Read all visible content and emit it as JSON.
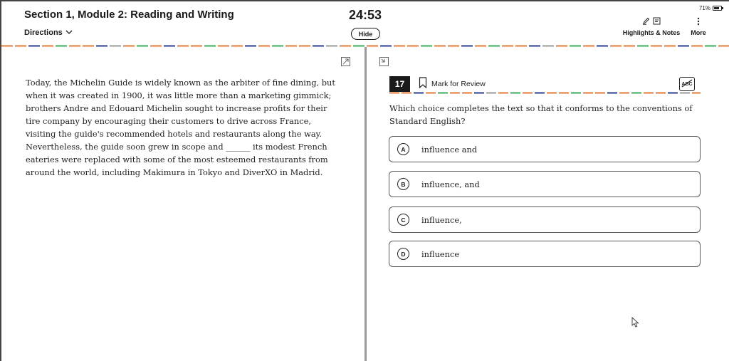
{
  "header": {
    "section_title": "Section 1, Module 2: Reading and Writing",
    "directions_label": "Directions",
    "timer": "24:53",
    "hide_label": "Hide",
    "battery": "71%",
    "highlights_label": "Highlights & Notes",
    "more_label": "More"
  },
  "passage": {
    "text": "Today, the Michelin Guide is widely known as the arbiter of fine dining, but when it was created in 1900, it was little more than a marketing gimmick; brothers Andre and Edouard Michelin sought to increase profits for their tire company by encouraging their customers to drive across France, visiting the guide's recommended hotels and restaurants along the way. Nevertheless, the guide soon grew in scope and ______ its modest French eateries were replaced with some of the most esteemed restaurants from around the world, including Makimura in Tokyo and DiverXO in Madrid."
  },
  "question": {
    "number": "17",
    "mark_for_review_label": "Mark for Review",
    "abc_label": "ABC",
    "prompt": "Which choice completes the text so that it conforms to the conventions of Standard English?",
    "choices": [
      {
        "letter": "A",
        "text": "influence and"
      },
      {
        "letter": "B",
        "text": "influence, and"
      },
      {
        "letter": "C",
        "text": "influence,"
      },
      {
        "letter": "D",
        "text": "influence"
      }
    ]
  },
  "icons": {
    "directions": "chevron-down-icon",
    "highlight": "pen-icon",
    "notes": "note-icon",
    "more": "vertical-dots-icon",
    "expand": "expand-icon",
    "collapse": "collapse-icon",
    "bookmark": "bookmark-icon",
    "abc": "strikethrough-abc-icon",
    "battery": "battery-icon",
    "cursor": "mouse-cursor-icon"
  },
  "colors": {
    "dash_segments": [
      "#e07a3a",
      "#2b3d8f",
      "#3aaa5a",
      "#9a9a9a"
    ],
    "question_number_bg": "#1a1a1a"
  }
}
